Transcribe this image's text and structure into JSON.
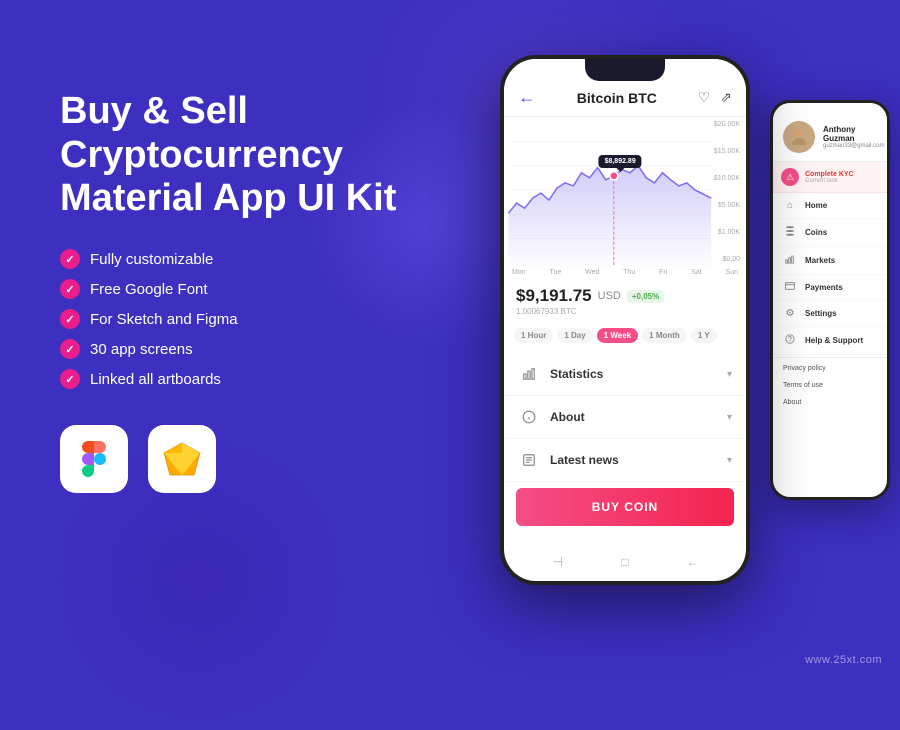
{
  "page": {
    "background": "#3d2fc0",
    "watermark": "www.25xt.com"
  },
  "left": {
    "title": "Buy & Sell\nCryptocurrency\nMaterial App UI Kit",
    "features": [
      "Fully customizable",
      "Free Google Font",
      "For Sketch and Figma",
      "30 app screens",
      "Linked all artboards"
    ],
    "tools": [
      {
        "name": "Figma",
        "icon": "🎨"
      },
      {
        "name": "Sketch",
        "icon": "💎"
      }
    ]
  },
  "phone_main": {
    "header": {
      "back_icon": "←",
      "title": "Bitcoin BTC",
      "heart_icon": "♡",
      "share_icon": "⇗"
    },
    "chart": {
      "tooltip": "$8,892.89",
      "y_labels": [
        "$20.00K",
        "$15.00K",
        "$10.00K",
        "$5.00K",
        "$1.00K",
        "$0.00"
      ],
      "x_labels": [
        "Mon",
        "Tue",
        "Wed",
        "Thu",
        "Fri",
        "Sat",
        "Sun"
      ]
    },
    "price": {
      "value": "$9,191.75",
      "currency": "USD",
      "badge": "+0,05%",
      "btc": "1.00067933 BTC"
    },
    "time_tabs": [
      {
        "label": "1 Hour",
        "active": false
      },
      {
        "label": "1 Day",
        "active": false
      },
      {
        "label": "1 Week",
        "active": true
      },
      {
        "label": "1 Month",
        "active": false
      },
      {
        "label": "1 Y",
        "active": false
      }
    ],
    "accordion": [
      {
        "label": "Statistics",
        "icon": "📊"
      },
      {
        "label": "About",
        "icon": "ℹ"
      },
      {
        "label": "Latest news",
        "icon": "📰"
      }
    ],
    "buy_btn": "BUY COIN",
    "nav_btns": [
      "⊣",
      "□",
      "←"
    ]
  },
  "phone_right": {
    "user": {
      "name": "Anthony Guzman",
      "email": "guzman33@gmail.com",
      "avatar": "👤"
    },
    "kyc": {
      "title": "Complete KYC",
      "subtitle": "Current task"
    },
    "nav_items": [
      {
        "label": "Home",
        "icon": "⌂"
      },
      {
        "label": "Coins",
        "icon": "≈"
      },
      {
        "label": "Markets",
        "icon": "📈"
      },
      {
        "label": "Payments",
        "icon": "💳"
      },
      {
        "label": "Settings",
        "icon": "⚙"
      },
      {
        "label": "Help & Support",
        "icon": "?"
      }
    ],
    "links": [
      "Privacy policy",
      "Terms of use",
      "About"
    ]
  }
}
